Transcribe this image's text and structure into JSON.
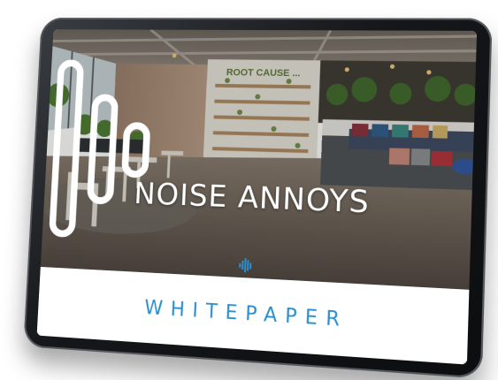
{
  "document": {
    "title": "NOISE ANNOYS",
    "subtitle": "WHITEPAPER",
    "wall_sign": "ROOT CAUSE ..."
  },
  "icons": {
    "logo": "sound-wave-icon",
    "accent": "small-wave-icon"
  },
  "colors": {
    "subtitle": "#2a8fd0",
    "bezel": "#15171a"
  }
}
